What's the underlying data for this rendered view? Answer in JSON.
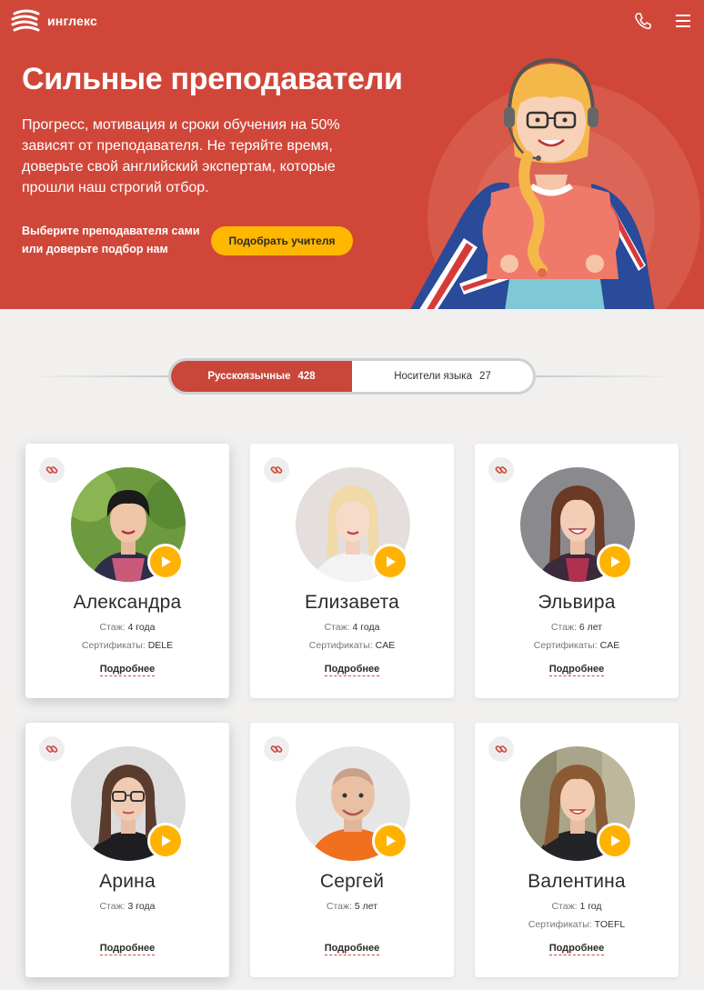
{
  "header": {
    "logo_text": "инглекс",
    "phone_icon": "phone-icon",
    "menu_icon": "menu-icon"
  },
  "hero": {
    "title": "Сильные преподаватели",
    "description": "Прогресс, мотивация и сроки обучения на 50% зависят от преподавателя. Не теряйте время, доверьте свой английский экспертам, которые прошли наш строгий отбор.",
    "cta_text": "Выберите преподавателя сами или доверьте подбор нам",
    "cta_button": "Подобрать учителя",
    "bg_color": "#d0473a",
    "accent_color": "#ffb700"
  },
  "tabs": [
    {
      "label": "Русскоязычные",
      "count": "428",
      "active": true
    },
    {
      "label": "Носители языка",
      "count": "27",
      "active": false
    }
  ],
  "labels": {
    "experience_prefix": "Стаж:",
    "certificates_prefix": "Сертификаты:",
    "more_link": "Подробнее"
  },
  "teachers": [
    {
      "name": "Александра",
      "experience": "4 года",
      "certificates": "DELE"
    },
    {
      "name": "Елизавета",
      "experience": "4 года",
      "certificates": "CAE"
    },
    {
      "name": "Эльвира",
      "experience": "6 лет",
      "certificates": "CAE"
    },
    {
      "name": "Арина",
      "experience": "3 года",
      "certificates": ""
    },
    {
      "name": "Сергей",
      "experience": "5 лет",
      "certificates": ""
    },
    {
      "name": "Валентина",
      "experience": "1 год",
      "certificates": "TOEFL"
    }
  ]
}
